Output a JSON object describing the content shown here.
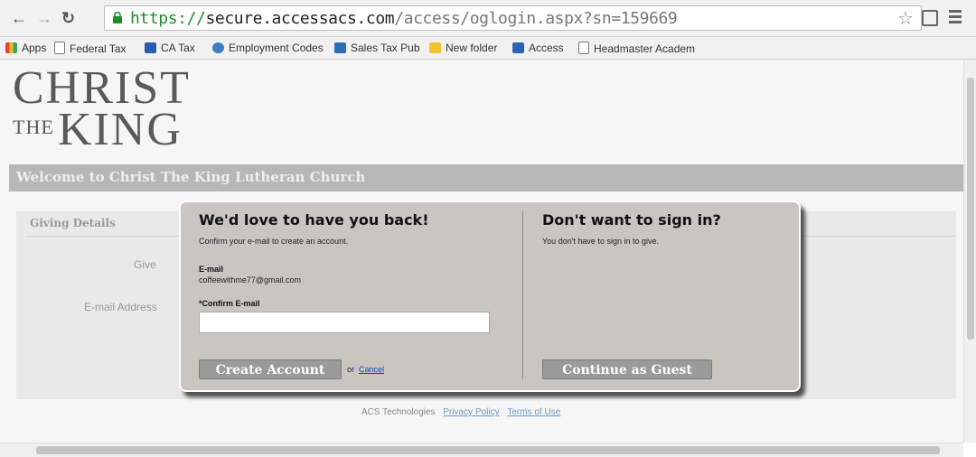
{
  "browser": {
    "url": {
      "protocol": "https://",
      "host": "secure.accessacs.com",
      "path": "/access/oglogin.aspx?sn=159669"
    },
    "bookmarks": [
      {
        "label": "Apps",
        "icon": "apps-grid-icon",
        "color": "#e0452b"
      },
      {
        "label": "Federal Tax",
        "icon": "page-icon",
        "color": "#ffffff"
      },
      {
        "label": "CA Tax",
        "icon": "ftb-icon",
        "color": "#2a5db0"
      },
      {
        "label": "Employment Codes",
        "icon": "edd-icon",
        "color": "#3a7fc2"
      },
      {
        "label": "Sales Tax Pub",
        "icon": "boe-icon",
        "color": "#2a6fb8"
      },
      {
        "label": "New folder",
        "icon": "folder-icon",
        "color": "#f2c230"
      },
      {
        "label": "Access",
        "icon": "access-icon",
        "color": "#2c64b5"
      },
      {
        "label": "Headmaster Academ",
        "icon": "page-icon",
        "color": "#ffffff"
      }
    ]
  },
  "page": {
    "logo": {
      "line1": "CHRIST",
      "line2": "THE",
      "line3": "KING"
    },
    "welcome": "Welcome to Christ The King Lutheran Church",
    "panel": {
      "header": "Giving Details",
      "give_label": "Give",
      "email_label": "E-mail Address"
    },
    "footer": {
      "company": "ACS Technologies",
      "privacy": "Privacy Policy",
      "terms": "Terms of Use"
    }
  },
  "modal": {
    "left": {
      "title": "We'd love to have you back!",
      "subtitle": "Confirm your e-mail to create an account.",
      "email_label": "E-mail",
      "email_value": "coffeewithme77@gmail.com",
      "confirm_label": "*Confirm E-mail",
      "confirm_value": "",
      "create_button": "Create Account",
      "or_text": "or",
      "cancel_link": "Cancel"
    },
    "right": {
      "title": "Don't want to sign in?",
      "subtitle": "You don't have to sign in to give.",
      "guest_button": "Continue as Guest"
    }
  }
}
